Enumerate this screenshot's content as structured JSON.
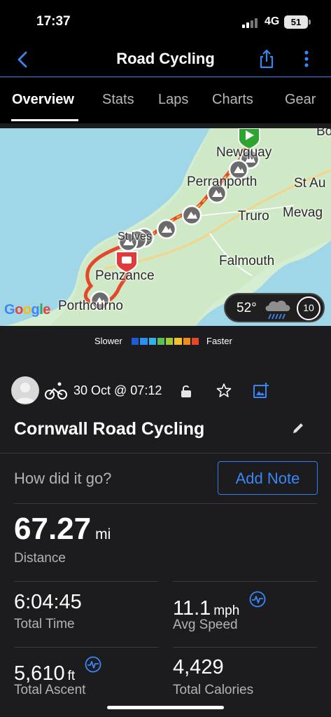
{
  "status_bar": {
    "time": "17:37",
    "network": "4G",
    "battery": "51"
  },
  "nav": {
    "title": "Road Cycling"
  },
  "tabs": [
    "Overview",
    "Stats",
    "Laps",
    "Charts",
    "Gear"
  ],
  "map": {
    "labels": [
      "Newquay",
      "Perranporth",
      "St Au",
      "Truro",
      "Mevag",
      "Falmouth",
      "Penzance",
      "Porthcurno",
      "St Ives",
      "Bo"
    ],
    "provider": "Google",
    "weather": {
      "temperature": "52°",
      "wind": "10",
      "icon": "rain-cloud-icon"
    }
  },
  "legend": {
    "slower": "Slower",
    "faster": "Faster",
    "colors": [
      "#1e5bd6",
      "#2f8ff0",
      "#35b0e8",
      "#58c05a",
      "#a3c93a",
      "#f2c12e",
      "#f08a24",
      "#e4482b"
    ]
  },
  "activity": {
    "date": "30 Oct @ 07:12",
    "title": "Cornwall Road Cycling",
    "feedback_prompt": "How did it go?",
    "add_note": "Add Note"
  },
  "stats": {
    "distance": {
      "value": "67.27",
      "unit": "mi",
      "label": "Distance"
    },
    "total_time": {
      "value": "6:04:45",
      "label": "Total Time"
    },
    "avg_speed": {
      "value": "11.1",
      "unit": "mph",
      "label": "Avg Speed"
    },
    "total_ascent": {
      "value": "5,610",
      "unit": "ft",
      "label": "Total Ascent"
    },
    "total_calories": {
      "value": "4,429",
      "label": "Total Calories"
    }
  },
  "colors": {
    "accent": "#2f7ff2",
    "background": "#1c1c1e"
  }
}
